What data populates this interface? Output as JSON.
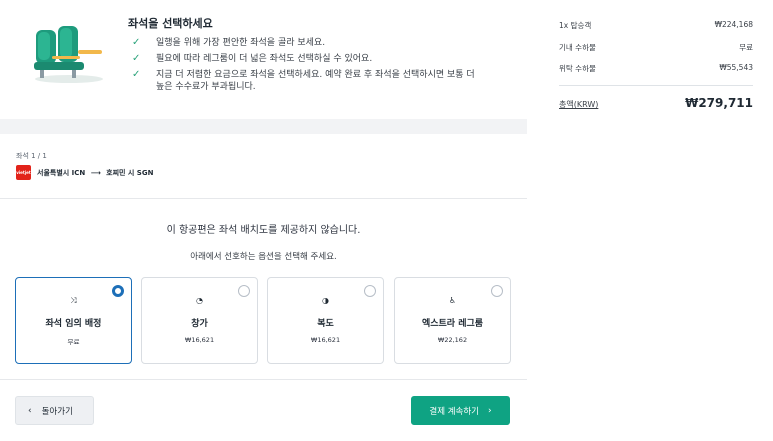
{
  "intro": {
    "title": "좌석을 선택하세요",
    "bullets": [
      "일행을 위해 가장 편안한 좌석을 골라 보세요.",
      "필요에 따라 레그룸이 더 넓은 좌석도 선택하실 수 있어요.",
      "지금 더 저렴한 요금으로 좌석을 선택하세요. 예약 완료 후 좌석을 선택하시면 보통 더",
      "높은 수수료가 부과됩니다."
    ],
    "check_icon": "check-icon",
    "illustration": "airplane-seats-illustration",
    "accent_color": "#2ba37b"
  },
  "segment": {
    "label": "좌석 1 / 1",
    "airline_logo_text": "vietjet",
    "origin": "서울특별시 ICN",
    "arrow": "⟶",
    "destination": "호찌민 시 SGN"
  },
  "seatmap": {
    "unavailable_text": "이 항공편은 좌석 배치도를 제공하지 않습니다.",
    "choose_text": "아래에서 선호하는 옵션을 선택해 주세요."
  },
  "options": [
    {
      "icon": "shuffle-icon",
      "glyph": "⤨",
      "name": "좌석 임의 배정",
      "price": "무료",
      "selected": true
    },
    {
      "icon": "window-seat-icon",
      "glyph": "◔",
      "name": "창가",
      "price": "₩16,621",
      "selected": false
    },
    {
      "icon": "aisle-seat-icon",
      "glyph": "◑",
      "name": "복도",
      "price": "₩16,621",
      "selected": false
    },
    {
      "icon": "legroom-icon",
      "glyph": "♿",
      "name": "엑스트라 레그룸",
      "price": "₩22,162",
      "selected": false
    }
  ],
  "actions": {
    "back_label": "돌아가기",
    "back_icon": "chevron-left-icon",
    "next_label": "결제 계속하기",
    "next_icon": "chevron-right-icon",
    "primary_color": "#0fa383"
  },
  "summary": {
    "rows": [
      {
        "label": "1x 탑승객",
        "value": "₩224,168"
      },
      {
        "label": "기내 수하물",
        "value": "무료"
      },
      {
        "label": "위탁 수하물",
        "value": "₩55,543"
      }
    ],
    "total_label": "총액(KRW)",
    "total_value": "₩279,711"
  }
}
